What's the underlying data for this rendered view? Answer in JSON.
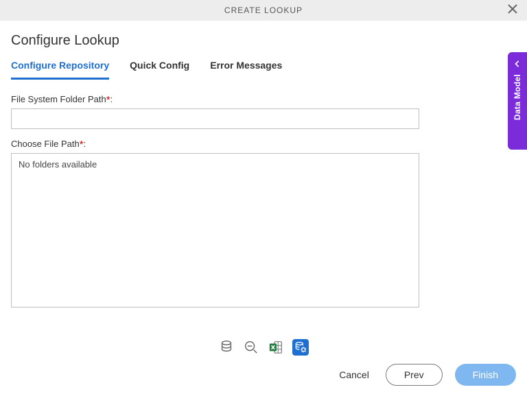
{
  "header": {
    "title": "CREATE LOOKUP"
  },
  "page": {
    "title": "Configure Lookup"
  },
  "tabs": [
    {
      "label": "Configure Repository",
      "active": true
    },
    {
      "label": "Quick Config",
      "active": false
    },
    {
      "label": "Error Messages",
      "active": false
    }
  ],
  "form": {
    "fs_path_label": "File System Folder Path",
    "fs_path_value": "",
    "choose_path_label": "Choose File Path",
    "no_folders_text": "No folders available"
  },
  "toolbar_icons": {
    "db": "database-icon",
    "minus": "zoom-out-icon",
    "excel": "excel-icon",
    "db_cog": "database-config-icon"
  },
  "footer": {
    "cancel": "Cancel",
    "prev": "Prev",
    "finish": "Finish"
  },
  "sidepanel": {
    "label": "Data Model"
  },
  "colors": {
    "accent": "#1f6fd0",
    "side": "#7b2bd9",
    "primary_btn": "#7fb8f0"
  }
}
